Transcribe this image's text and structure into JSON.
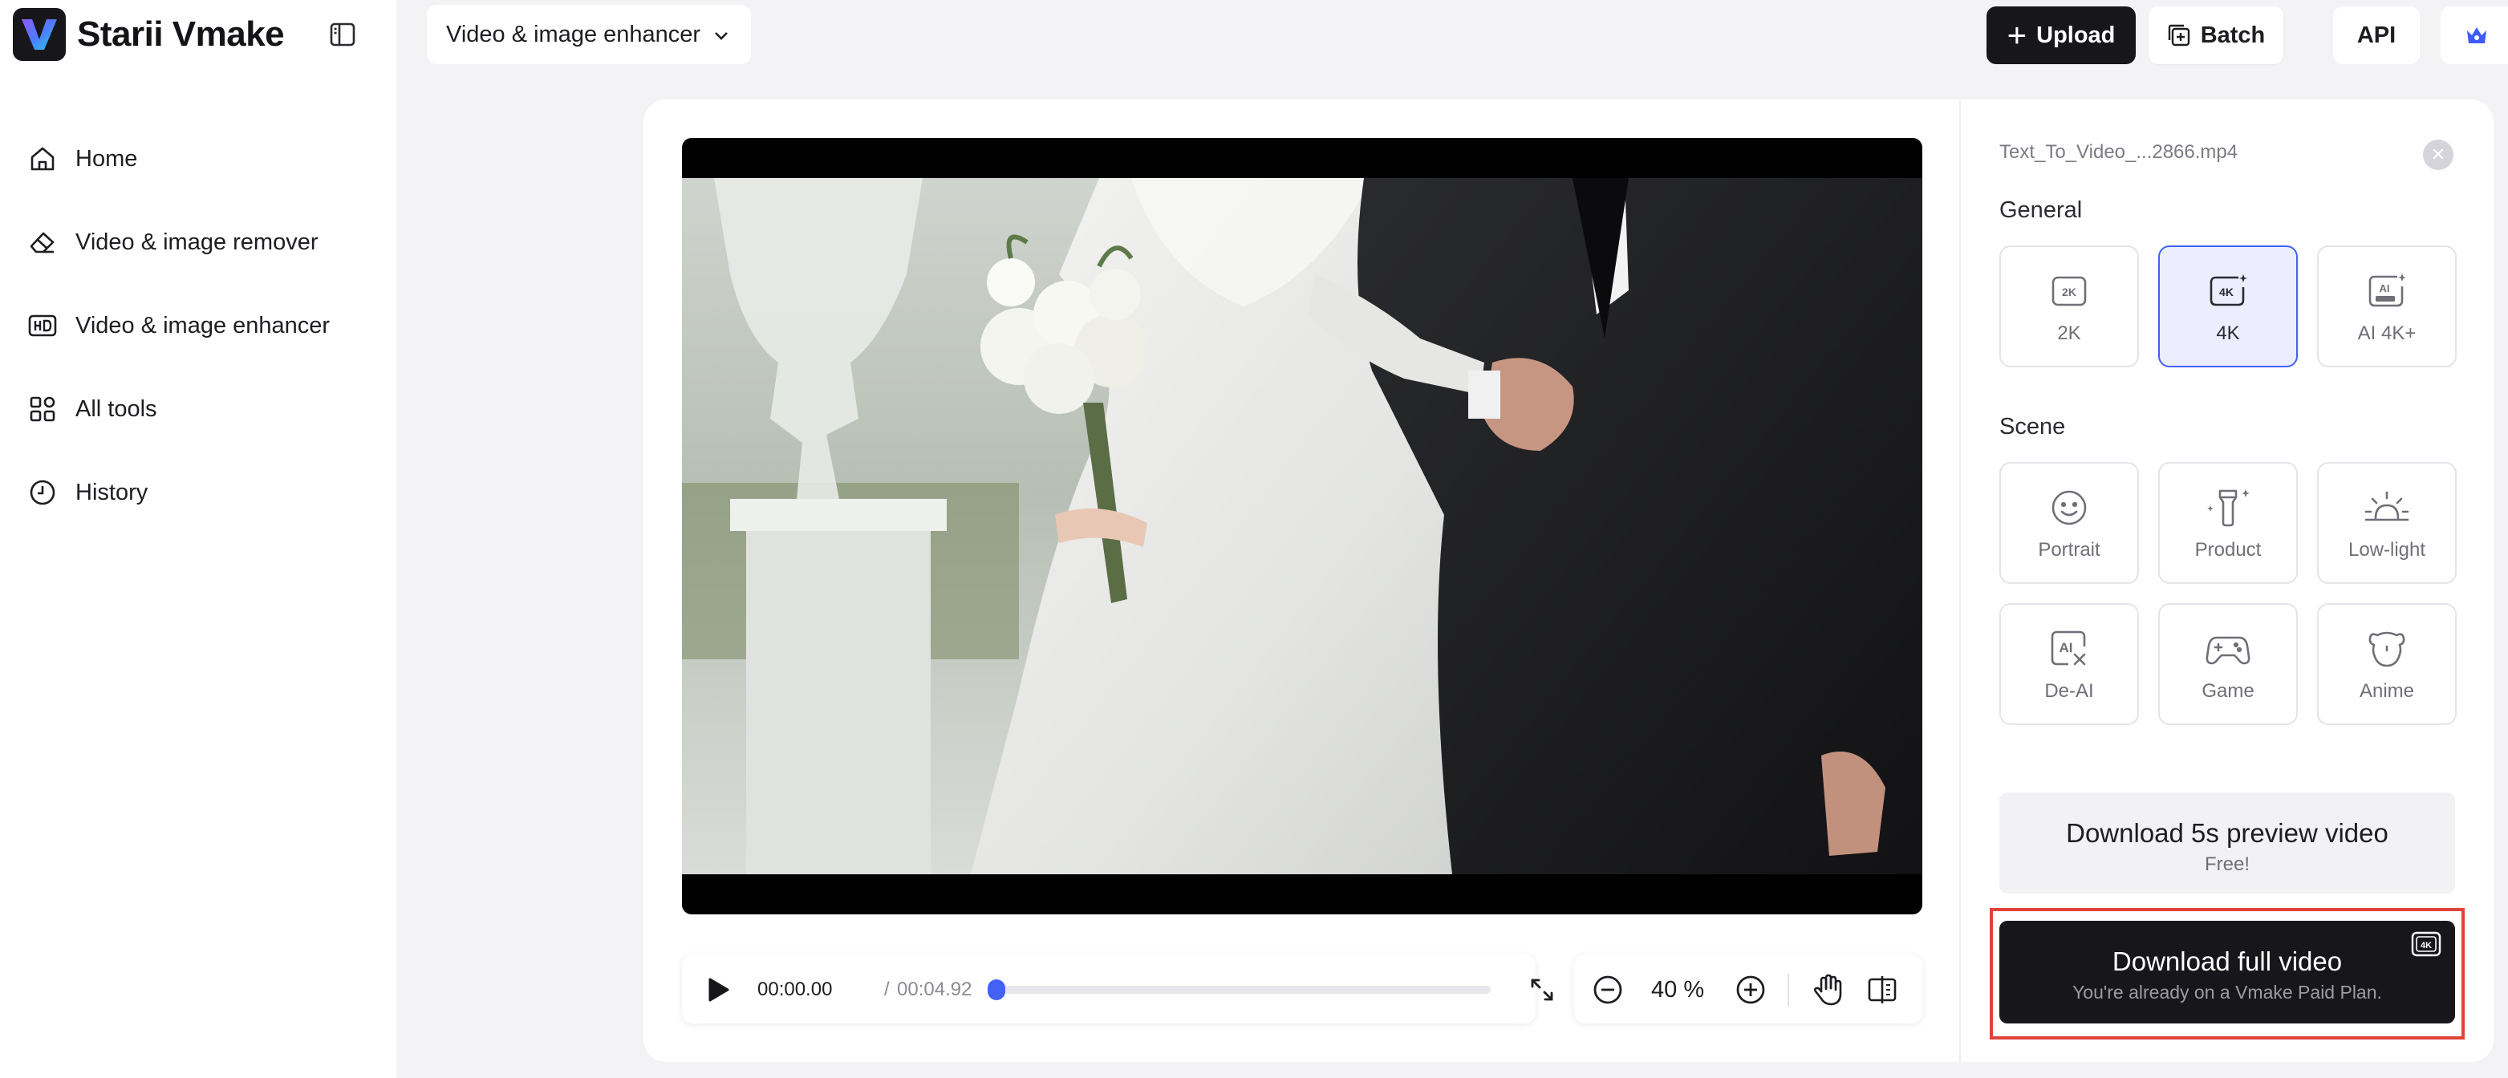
{
  "brand": {
    "name": "Starii Vmake"
  },
  "sidebar": {
    "items": [
      {
        "label": "Home",
        "icon": "home-icon"
      },
      {
        "label": "Video & image remover",
        "icon": "eraser-icon"
      },
      {
        "label": "Video & image enhancer",
        "icon": "hd-icon"
      },
      {
        "label": "All tools",
        "icon": "grid-icon"
      },
      {
        "label": "History",
        "icon": "clock-icon"
      }
    ]
  },
  "header": {
    "mode_select": "Video & image enhancer",
    "upload_label": "Upload",
    "batch_label": "Batch",
    "api_label": "API"
  },
  "player": {
    "current_time": "00:00.00",
    "separator": "/",
    "total_time": "00:04.92",
    "progress": 0.0
  },
  "zoom": {
    "value": "40 %"
  },
  "panel": {
    "filename": "Text_To_Video_...2866.mp4",
    "general_title": "General",
    "general_options": [
      {
        "label": "2K",
        "icon": "2k-icon"
      },
      {
        "label": "4K",
        "icon": "4k-icon",
        "selected": true
      },
      {
        "label": "AI 4K+",
        "icon": "ai-ultra-icon"
      }
    ],
    "scene_title": "Scene",
    "scene_options": [
      {
        "label": "Portrait",
        "icon": "smiley-icon"
      },
      {
        "label": "Product",
        "icon": "bottle-icon"
      },
      {
        "label": "Low-light",
        "icon": "sunrise-icon"
      },
      {
        "label": "De-AI",
        "icon": "de-ai-icon"
      },
      {
        "label": "Game",
        "icon": "gamepad-icon"
      },
      {
        "label": "Anime",
        "icon": "bear-icon"
      }
    ],
    "download_preview": {
      "title": "Download 5s preview video",
      "subtitle": "Free!"
    },
    "download_full": {
      "title": "Download full video",
      "subtitle": "You're already on a Vmake Paid Plan."
    }
  },
  "colors": {
    "accent": "#4361f5",
    "dark_button": "#17171b",
    "highlight_border": "#e0433a",
    "selected_bg": "#eceeff"
  }
}
